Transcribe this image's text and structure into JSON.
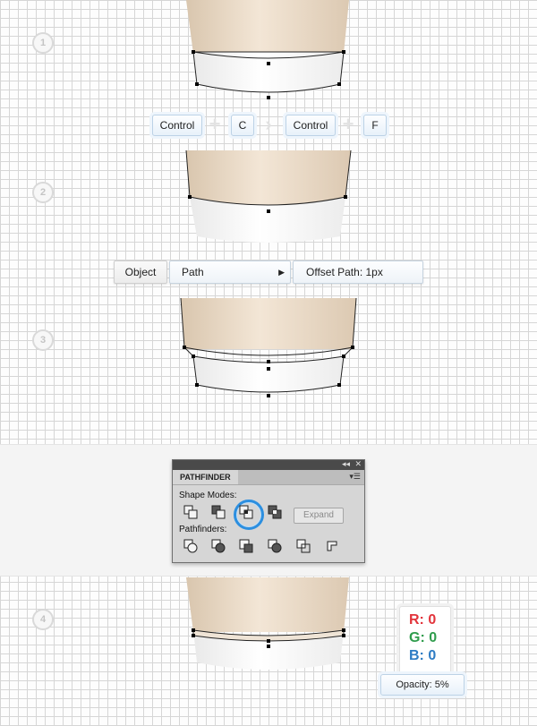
{
  "steps": [
    "1",
    "2",
    "3",
    "4"
  ],
  "shortcut": {
    "key1": "Control",
    "key2": "C",
    "key3": "Control",
    "key4": "F"
  },
  "menu": {
    "object": "Object",
    "path": "Path",
    "offset_path": "Offset Path: 1px"
  },
  "pathfinder": {
    "title": "PATHFINDER",
    "shape_modes": "Shape Modes:",
    "pathfinders": "Pathfinders:",
    "expand": "Expand",
    "collapse_icon": "double-chevron-icon",
    "close_icon": "close-icon",
    "menu_icon": "panel-menu-icon"
  },
  "color": {
    "r": "R: 0",
    "g": "G: 0",
    "b": "B: 0",
    "opacity": "Opacity: 5%"
  },
  "colors": {
    "cup_tan": "#eadbc9",
    "sleeve_white": "#f4f4f4",
    "accent_blue": "#2c8fe0",
    "r_red": "#e2343b",
    "g_green": "#2f9c4c",
    "b_blue": "#2d7cc4"
  }
}
